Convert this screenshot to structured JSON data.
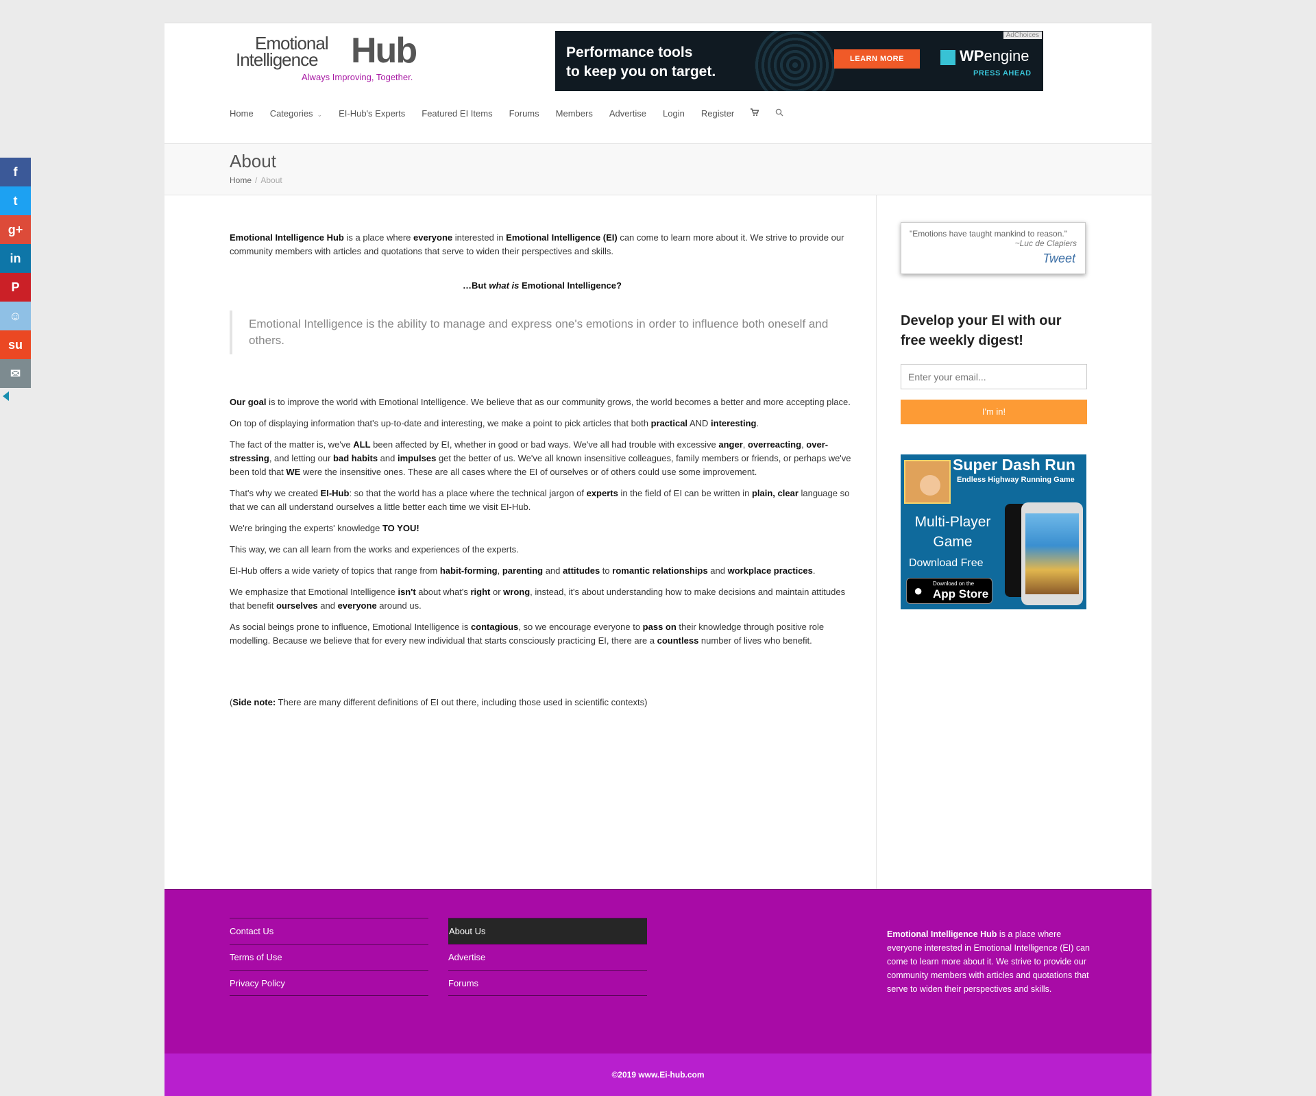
{
  "header": {
    "logo_line1": "Emotional",
    "logo_line2": "Intelligence",
    "logo_hub": "Hub",
    "logo_tagline": "Always Improving, Together."
  },
  "ad": {
    "adchoices": "AdChoices",
    "headline_line1": "Performance tools",
    "headline_line2": "to keep you on target.",
    "button": "LEARN MORE",
    "brand_bold": "WP",
    "brand_rest": "engine",
    "brand_tag": "PRESS AHEAD"
  },
  "nav": {
    "items": [
      "Home",
      "Categories",
      "EI-Hub's Experts",
      "Featured EI Items",
      "Forums",
      "Members",
      "Advertise",
      "Login",
      "Register"
    ],
    "cart_icon": "shopping-cart-icon",
    "search_icon": "search-icon"
  },
  "title_bar": {
    "title": "About",
    "crumb_home": "Home",
    "crumb_sep": "/",
    "crumb_current": "About"
  },
  "content": {
    "p1_b1": "Emotional Intelligence Hub",
    "p1_t1": " is a place where ",
    "p1_b2": "everyone",
    "p1_t2": " interested in ",
    "p1_b3": "Emotional Intelligence (EI)",
    "p1_t3": " can come to learn more about it. We strive to provide our community members with articles and quotations that serve to widen their perspectives and skills.",
    "q_t1": "…But ",
    "q_i1": "what is",
    "q_t2": " Emotional Intelligence?",
    "definition": "Emotional Intelligence is the ability to manage and express one's emotions in order to influence both oneself and others.",
    "p2_b1": "Our goal",
    "p2_t1": " is to improve the world with Emotional Intelligence. We believe that as our community grows, the world becomes a better and more accepting place.",
    "p3_t1": "On top of displaying information that's up-to-date and interesting, we make a point to pick articles that both ",
    "p3_b1": "practical",
    "p3_t2": " AND ",
    "p3_b2": "interesting",
    "p3_t3": ".",
    "p4_t1": "The fact of the matter is, we've ",
    "p4_b1": "ALL",
    "p4_t2": " been affected by EI, whether in good or bad ways. We've all had trouble with excessive ",
    "p4_b2": "anger",
    "p4_t3": ", ",
    "p4_b3": "overreacting",
    "p4_t4": ", ",
    "p4_b4": "over-stressing",
    "p4_t5": ", and letting our ",
    "p4_b5": "bad habits",
    "p4_t6": " and ",
    "p4_b6": "impulses",
    "p4_t7": " get the better of us. We've all known insensitive colleagues, family members or friends, or perhaps we've been told that ",
    "p4_b7": "WE",
    "p4_t8": " were the insensitive ones. These are all cases where the EI of ourselves or of others could use some improvement.",
    "p5_t1": "That's why we created ",
    "p5_b1": "EI-Hub",
    "p5_t2": ": so that the world has a place where the technical jargon of ",
    "p5_b2": "experts",
    "p5_t3": " in the field of EI can be written in ",
    "p5_b3": "plain, clear",
    "p5_t4": " language so that we can all understand ourselves a little better each time we visit EI-Hub.",
    "p6_t1": "We're bringing the experts' knowledge ",
    "p6_b1": "TO YOU!",
    "p7": "This way, we can all learn from the works and experiences of the experts.",
    "p8_t1": "EI-Hub offers a wide variety of topics that range from ",
    "p8_b1": "habit-forming",
    "p8_t2": ", ",
    "p8_b2": "parenting",
    "p8_t3": " and ",
    "p8_b3": "attitudes",
    "p8_t4": " to ",
    "p8_b4": "romantic relationships",
    "p8_t5": " and ",
    "p8_b5": "workplace practices",
    "p8_t6": ".",
    "p9_t1": "We emphasize that Emotional Intelligence ",
    "p9_b1": "isn't",
    "p9_t2": " about what's ",
    "p9_b2": "right",
    "p9_t3": " or ",
    "p9_b3": "wrong",
    "p9_t4": ", instead, it's about understanding how to make decisions and maintain attitudes that benefit ",
    "p9_b4": "ourselves",
    "p9_t5": " and ",
    "p9_b5": "everyone",
    "p9_t6": " around us.",
    "p10_t1": "As social beings prone to influence, Emotional Intelligence is ",
    "p10_b1": "contagious",
    "p10_t2": ", so we encourage everyone to ",
    "p10_b2": "pass on",
    "p10_t3": " their knowledge through positive role modelling. Because we believe that for every new individual that starts consciously practicing EI, there are a ",
    "p10_b3": "countless",
    "p10_t4": " number of lives who benefit.",
    "side_t1": "(",
    "side_b1": "Side note:",
    "side_t2": " There are many different definitions of EI out there, including those used in scientific contexts)"
  },
  "sidebar": {
    "quote": "\"Emotions have taught mankind to reason.\"",
    "quote_author": "~Luc de Clapiers",
    "tweet": "Tweet",
    "digest_title": "Develop your EI with our free weekly digest!",
    "email_placeholder": "Enter your email...",
    "submit": "I'm in!",
    "game_title": "Super Dash Run",
    "game_subtitle": "Endless Highway Running Game",
    "game_mode": "Multi-Player Game",
    "game_download": "Download Free",
    "store_small": "Download on the",
    "store_big": "App Store"
  },
  "footer": {
    "col1": [
      "Contact Us",
      "Terms of Use",
      "Privacy Policy"
    ],
    "col2": [
      "About Us",
      "Advertise",
      "Forums"
    ],
    "about_bold": "Emotional Intelligence Hub",
    "about_text": " is a place where everyone interested in Emotional Intelligence (EI) can come to learn more about it. We strive to provide our community members with articles and quotations that serve to widen their perspectives and skills.",
    "copyright": "©2019 www.Ei-hub.com"
  },
  "share_bar": {
    "buttons": [
      {
        "name": "facebook-icon",
        "glyph": "f",
        "color": "#3b5998"
      },
      {
        "name": "twitter-icon",
        "glyph": "t",
        "color": "#1da1f2"
      },
      {
        "name": "google-plus-icon",
        "glyph": "g+",
        "color": "#dd4b39"
      },
      {
        "name": "linkedin-icon",
        "glyph": "in",
        "color": "#0e76a8"
      },
      {
        "name": "pinterest-icon",
        "glyph": "P",
        "color": "#cb2027"
      },
      {
        "name": "reddit-icon",
        "glyph": "☺",
        "color": "#8fc0e5"
      },
      {
        "name": "stumbleupon-icon",
        "glyph": "su",
        "color": "#eb4823"
      },
      {
        "name": "email-icon",
        "glyph": "✉",
        "color": "#7d8b90"
      }
    ]
  },
  "colors": {
    "accent": "#a81aa4",
    "footer": "#a80ba6",
    "copyright_bar": "#b81fce",
    "button": "#fd9b35"
  }
}
